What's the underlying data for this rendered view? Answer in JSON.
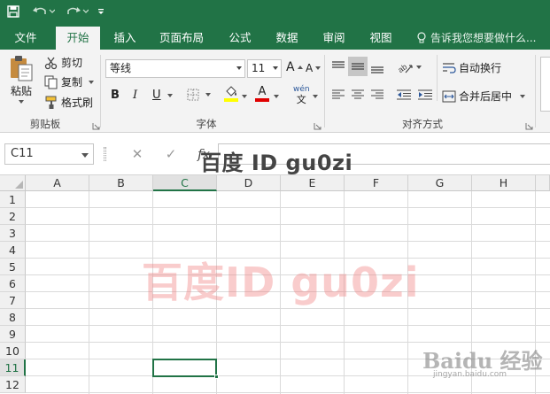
{
  "titlebar": {
    "bg_color": "#217346",
    "icons": [
      "save-icon",
      "undo-icon",
      "redo-icon",
      "customize-toolbar-icon"
    ]
  },
  "tabs": [
    {
      "label": "文件",
      "active": false
    },
    {
      "label": "开始",
      "active": true
    },
    {
      "label": "插入",
      "active": false
    },
    {
      "label": "页面布局",
      "active": false
    },
    {
      "label": "公式",
      "active": false
    },
    {
      "label": "数据",
      "active": false
    },
    {
      "label": "审阅",
      "active": false
    },
    {
      "label": "视图",
      "active": false
    }
  ],
  "tell_me": {
    "label": "告诉我您想要做什么..."
  },
  "ribbon": {
    "clipboard": {
      "paste_label": "粘贴",
      "cut_label": "剪切",
      "copy_label": "复制",
      "format_painter_label": "格式刷",
      "group_label": "剪贴板"
    },
    "font": {
      "font_name": "等线",
      "font_size": "11",
      "grow_label": "A",
      "shrink_label": "A",
      "bold_label": "B",
      "italic_label": "I",
      "underline_label": "U",
      "font_color_label": "A",
      "phonetic_label": "wén",
      "phonetic_sub": "文",
      "highlight_color": "#ffff00",
      "font_color": "#e00000",
      "group_label": "字体"
    },
    "alignment": {
      "wrap_text_label": "自动换行",
      "merge_center_label": "合并后居中",
      "group_label": "对齐方式"
    }
  },
  "formula_bar": {
    "name_box": "C11",
    "cancel_label": "✕",
    "enter_label": "✓",
    "function_label": "fx",
    "watermark": "百度 ID gu0zi"
  },
  "grid": {
    "columns": [
      "A",
      "B",
      "C",
      "D",
      "E",
      "F",
      "G",
      "H"
    ],
    "rows": [
      "1",
      "2",
      "3",
      "4",
      "5",
      "6",
      "7",
      "8",
      "9",
      "10",
      "11",
      "12"
    ],
    "selected_column": "C",
    "selected_row": "11",
    "accent_color": "#217346"
  },
  "watermarks": {
    "center_text": "百度ID gu0zi",
    "baidu_logo_text": "Baidu 经验",
    "baidu_url": "jingyan.baidu.com"
  }
}
